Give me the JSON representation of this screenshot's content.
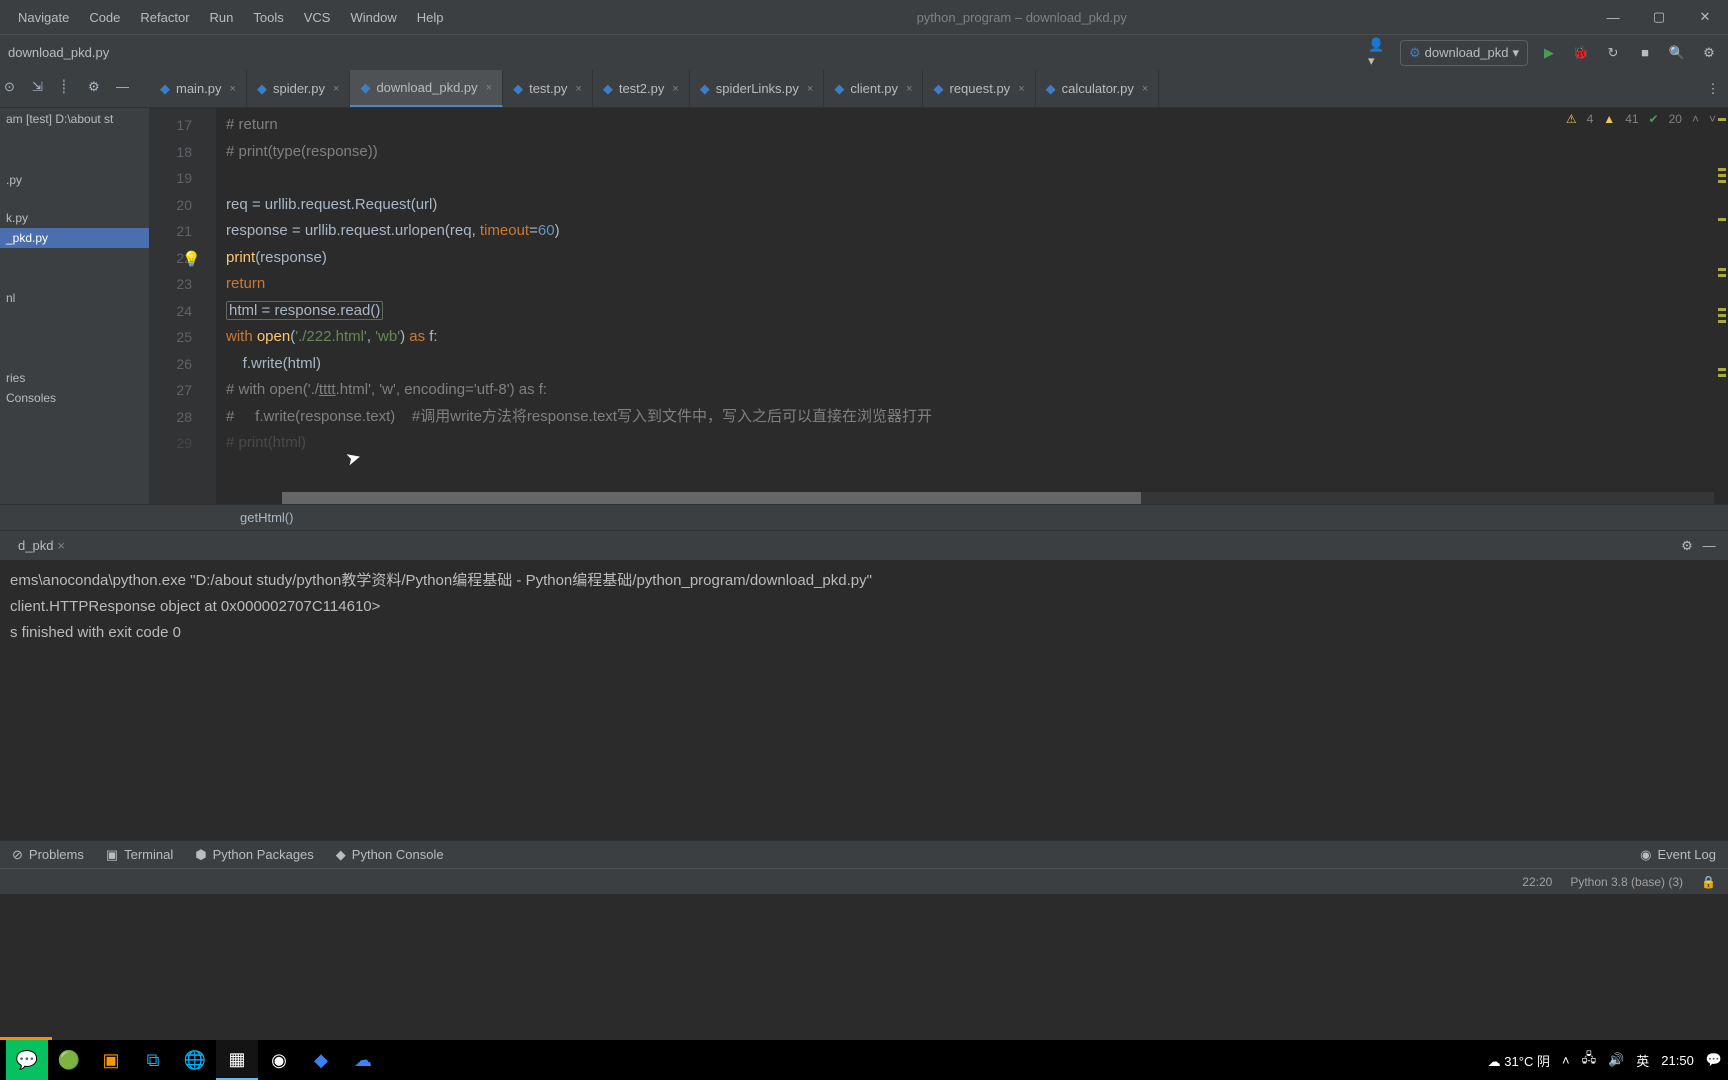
{
  "window": {
    "title": "python_program – download_pkd.py"
  },
  "menu": [
    "Navigate",
    "Code",
    "Refactor",
    "Run",
    "Tools",
    "VCS",
    "Window",
    "Help"
  ],
  "breadcrumb": "download_pkd.py",
  "run_config": {
    "name": "download_pkd"
  },
  "tabs": [
    {
      "label": "main.py",
      "active": false
    },
    {
      "label": "spider.py",
      "active": false
    },
    {
      "label": "download_pkd.py",
      "active": true
    },
    {
      "label": "test.py",
      "active": false
    },
    {
      "label": "test2.py",
      "active": false
    },
    {
      "label": "spiderLinks.py",
      "active": false
    },
    {
      "label": "client.py",
      "active": false
    },
    {
      "label": "request.py",
      "active": false
    },
    {
      "label": "calculator.py",
      "active": false
    }
  ],
  "sidebar": {
    "head": "am [test]  D:\\about st",
    "items": [
      {
        "label": ".py"
      },
      {
        "label": "k.py"
      },
      {
        "label": "_pkd.py",
        "selected": true
      },
      {
        "label": "nl"
      },
      {
        "label": "ries"
      },
      {
        "label": "Consoles"
      }
    ]
  },
  "editor": {
    "first_line": 17,
    "lines": [
      "# return",
      "# print(type(response))",
      "",
      "req = urllib.request.Request(url)",
      "response = urllib.request.urlopen(req, timeout=60)",
      "print(response)",
      "return",
      "html = response.read()",
      "with open('./222.html', 'wb') as f:",
      "    f.write(html)",
      "# with open('./tttt.html', 'w', encoding='utf-8') as f:",
      "#     f.write(response.text)    #调用write方法将response.text写入到文件中，写入之后可以直接在浏览器打开",
      "# print(html)"
    ],
    "inspections": {
      "yellow_triangle": "4",
      "yellow_warn": "41",
      "green_check": "20"
    },
    "breadcrumb": "getHtml()"
  },
  "console": {
    "tab": "d_pkd",
    "lines": [
      "ems\\anoconda\\python.exe \"D:/about study/python教学资料/Python编程基础 - Python编程基础/python_program/download_pkd.py\"",
      "client.HTTPResponse object at 0x000002707C114610>",
      "",
      "s finished with exit code 0"
    ]
  },
  "tool_buttons": [
    "Problems",
    "Terminal",
    "Python Packages",
    "Python Console"
  ],
  "event_log": "Event Log",
  "status": {
    "col": "22:20",
    "interpreter": "Python 3.8 (base) (3)"
  },
  "taskbar": {
    "weather": "31°C 阴",
    "ime": "英",
    "time": "21:50"
  }
}
